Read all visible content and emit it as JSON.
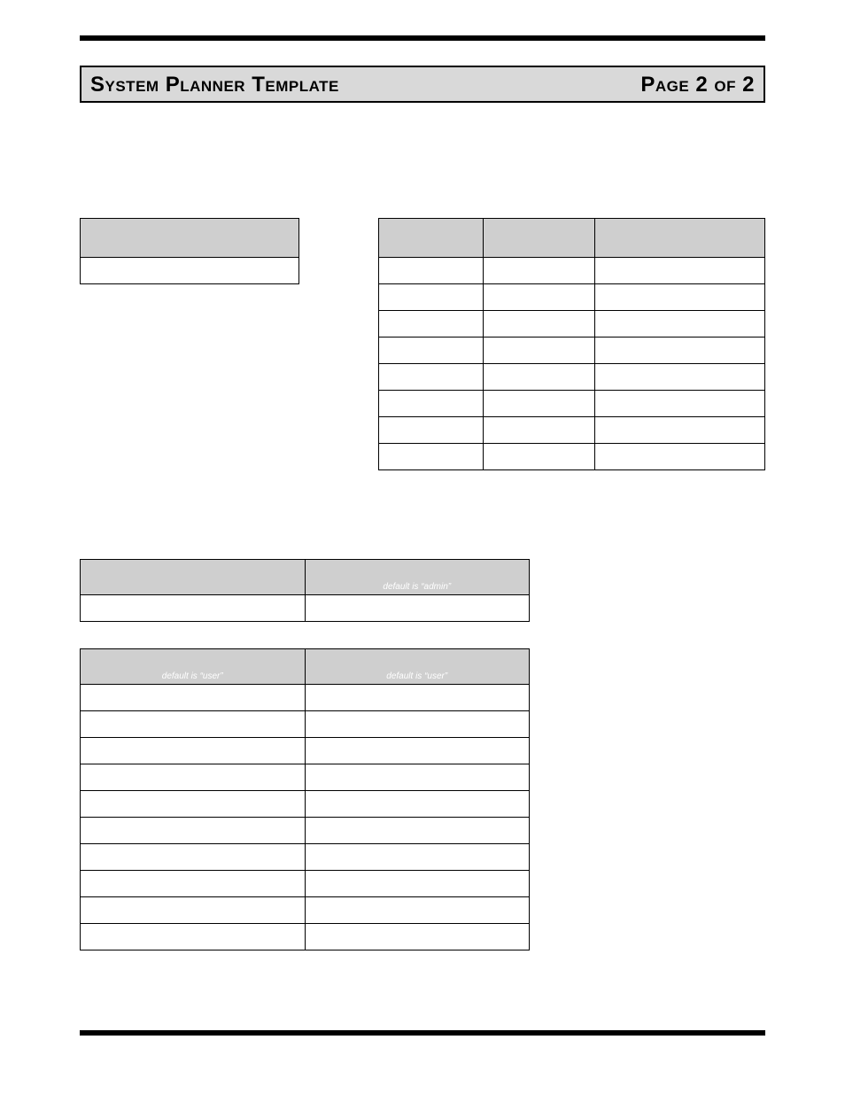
{
  "header": {
    "title": "System Planner Template",
    "page_label": "Page 2 of 2"
  },
  "smallTable": {
    "rowCount": 1
  },
  "rightTable": {
    "columns": 3,
    "rowCount": 8
  },
  "adminTable": {
    "header": {
      "col1_hint": "",
      "col2_hint": "default is “admin”"
    },
    "rowCount": 1
  },
  "userTable": {
    "header": {
      "col1_hint": "default is “user”",
      "col2_hint": "default is “user”"
    },
    "rowCount": 10
  }
}
